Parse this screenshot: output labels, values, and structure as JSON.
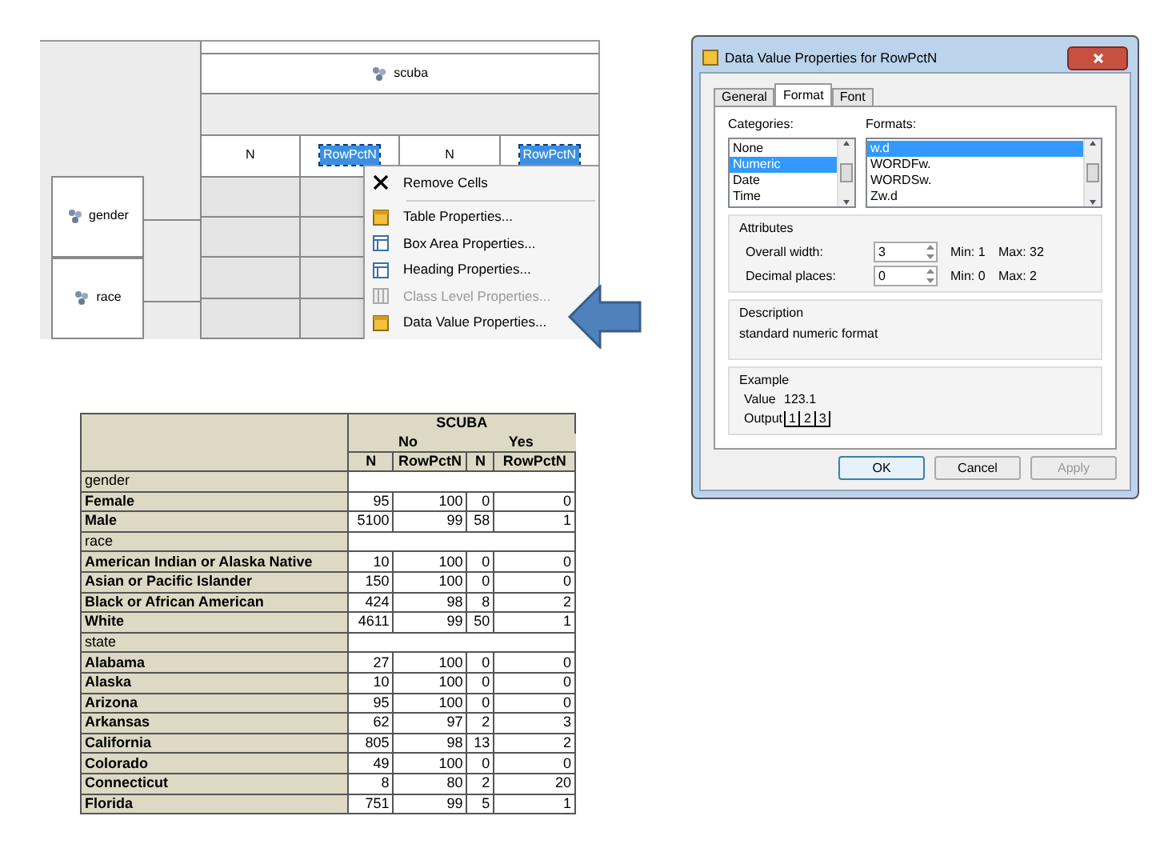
{
  "designer": {
    "column_header": "scuba",
    "columns": [
      {
        "label": "N",
        "selected": false
      },
      {
        "label": "RowPctN",
        "selected": true
      },
      {
        "label": "N",
        "selected": false
      },
      {
        "label": "RowPctN",
        "selected": true
      }
    ],
    "row_headers": [
      "gender",
      "race"
    ]
  },
  "context_menu": {
    "items": [
      {
        "kind": "remove",
        "label": "Remove Cells",
        "disabled": false
      },
      {
        "kind": "separator"
      },
      {
        "kind": "table",
        "label": "Table Properties...",
        "disabled": false
      },
      {
        "kind": "box",
        "label": "Box Area Properties...",
        "disabled": false
      },
      {
        "kind": "heading",
        "label": "Heading Properties...",
        "disabled": false
      },
      {
        "kind": "class",
        "label": "Class Level Properties...",
        "disabled": true
      },
      {
        "kind": "data",
        "label": "Data Value Properties...",
        "disabled": false
      }
    ]
  },
  "dialog": {
    "title": "Data Value Properties for RowPctN",
    "tabs": [
      {
        "label": "General",
        "selected": false
      },
      {
        "label": "Format",
        "selected": true
      },
      {
        "label": "Font",
        "selected": false
      }
    ],
    "categories": {
      "label": "Categories:",
      "items": [
        {
          "label": "None",
          "selected": false
        },
        {
          "label": "Numeric",
          "selected": true
        },
        {
          "label": "Date",
          "selected": false
        },
        {
          "label": "Time",
          "selected": false
        }
      ]
    },
    "formats": {
      "label": "Formats:",
      "items": [
        {
          "label": "w.d",
          "selected": true
        },
        {
          "label": "WORDFw.",
          "selected": false
        },
        {
          "label": "WORDSw.",
          "selected": false
        },
        {
          "label": "Zw.d",
          "selected": false
        }
      ]
    },
    "attributes": {
      "title": "Attributes",
      "fields": [
        {
          "label": "Overall width:",
          "value": "3",
          "min": "Min: 1",
          "max": "Max: 32"
        },
        {
          "label": "Decimal places:",
          "value": "0",
          "min": "Min: 0",
          "max": "Max: 2"
        }
      ]
    },
    "description": {
      "title": "Description",
      "text": "standard numeric format"
    },
    "example": {
      "title": "Example",
      "value_label": "Value",
      "value": "123.1",
      "output_label": "Output",
      "output": [
        "1",
        "2",
        "3"
      ]
    },
    "buttons": [
      {
        "label": "OK",
        "disabled": false,
        "focused": true
      },
      {
        "label": "Cancel",
        "disabled": false,
        "focused": false
      },
      {
        "label": "Apply",
        "disabled": true,
        "focused": false
      }
    ]
  },
  "report_table": {
    "title": "SCUBA",
    "groups": [
      "No",
      "Yes"
    ],
    "columns": [
      "N",
      "RowPctN",
      "N",
      "RowPctN"
    ],
    "rows": [
      {
        "kind": "group",
        "label": "gender"
      },
      {
        "kind": "item",
        "label": "Female",
        "cells": [
          "95",
          "100",
          "0",
          "0"
        ]
      },
      {
        "kind": "item",
        "label": "Male",
        "cells": [
          "5100",
          "99",
          "58",
          "1"
        ]
      },
      {
        "kind": "group",
        "label": "race"
      },
      {
        "kind": "item",
        "label": "American Indian or Alaska Native",
        "cells": [
          "10",
          "100",
          "0",
          "0"
        ]
      },
      {
        "kind": "item",
        "label": "Asian or Pacific Islander",
        "cells": [
          "150",
          "100",
          "0",
          "0"
        ]
      },
      {
        "kind": "item",
        "label": "Black or African American",
        "cells": [
          "424",
          "98",
          "8",
          "2"
        ]
      },
      {
        "kind": "item",
        "label": "White",
        "cells": [
          "4611",
          "99",
          "50",
          "1"
        ]
      },
      {
        "kind": "group",
        "label": "state"
      },
      {
        "kind": "item",
        "label": "Alabama",
        "cells": [
          "27",
          "100",
          "0",
          "0"
        ]
      },
      {
        "kind": "item",
        "label": "Alaska",
        "cells": [
          "10",
          "100",
          "0",
          "0"
        ]
      },
      {
        "kind": "item",
        "label": "Arizona",
        "cells": [
          "95",
          "100",
          "0",
          "0"
        ]
      },
      {
        "kind": "item",
        "label": "Arkansas",
        "cells": [
          "62",
          "97",
          "2",
          "3"
        ]
      },
      {
        "kind": "item",
        "label": "California",
        "cells": [
          "805",
          "98",
          "13",
          "2"
        ]
      },
      {
        "kind": "item",
        "label": "Colorado",
        "cells": [
          "49",
          "100",
          "0",
          "0"
        ]
      },
      {
        "kind": "item",
        "label": "Connecticut",
        "cells": [
          "8",
          "80",
          "2",
          "20"
        ]
      },
      {
        "kind": "item",
        "label": "Florida",
        "cells": [
          "751",
          "99",
          "5",
          "1"
        ]
      }
    ]
  }
}
